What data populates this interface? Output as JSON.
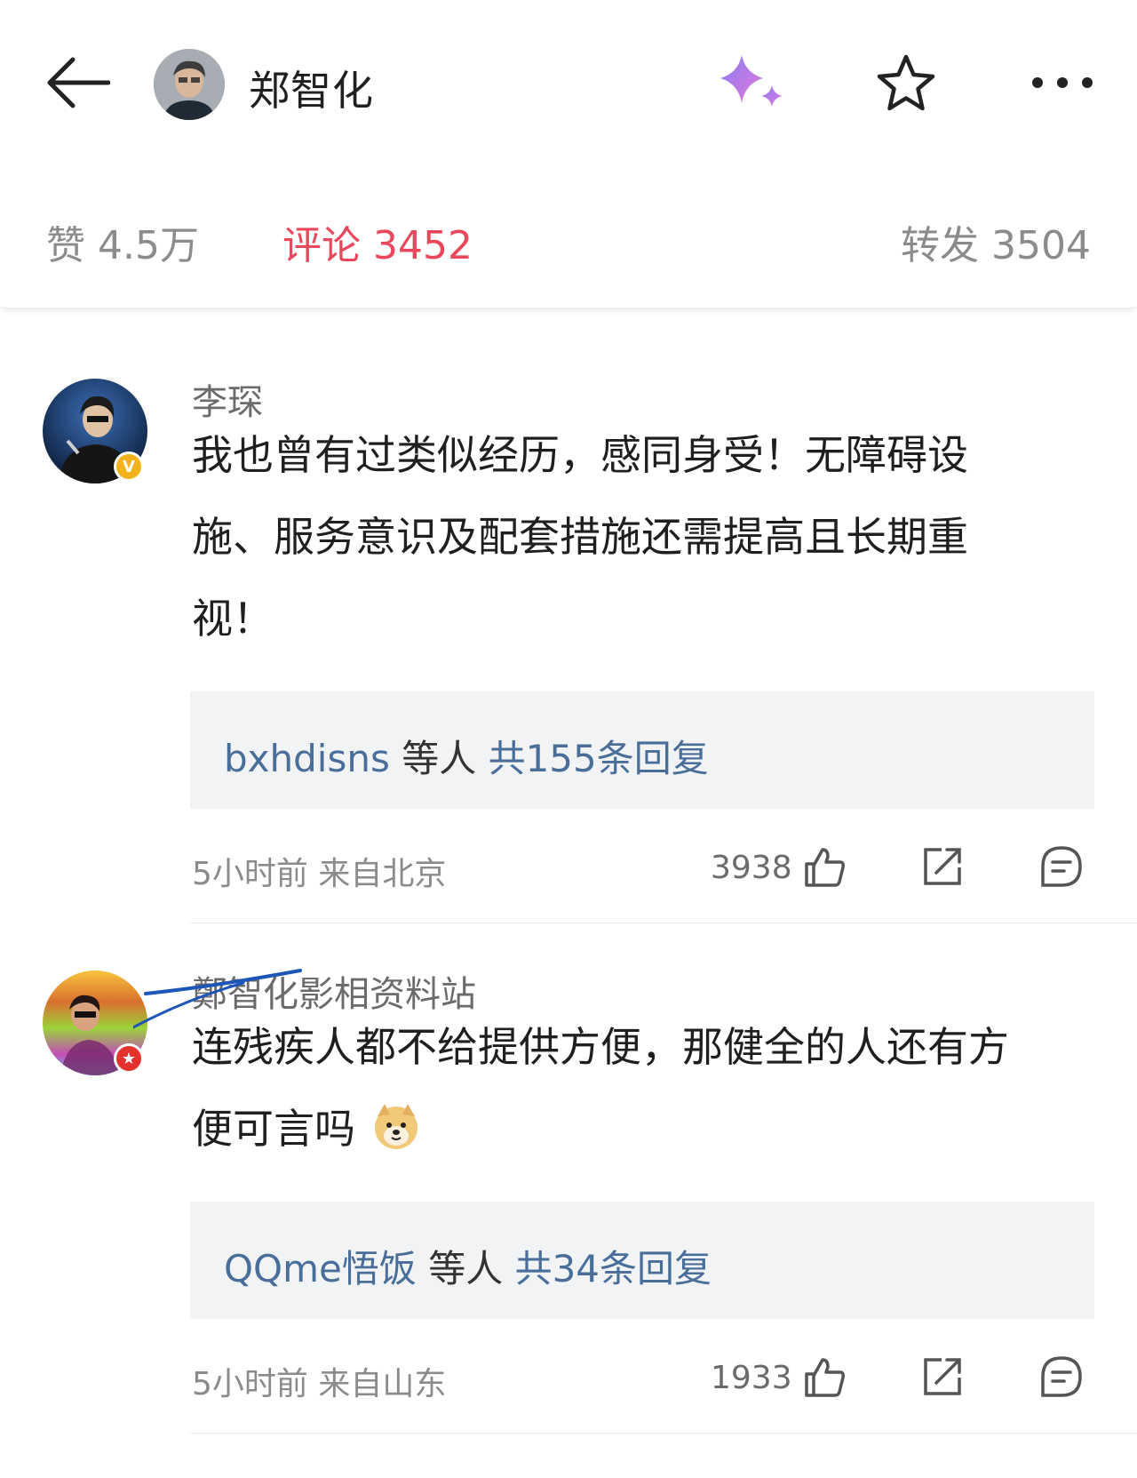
{
  "header": {
    "back_icon": "arrow-left-icon",
    "author_name": "郑智化",
    "ai_icon": "sparkle-icon",
    "favorite_icon": "star-icon",
    "more_icon": "more-dots-icon"
  },
  "stats": {
    "likes": "赞 4.5万",
    "comments": "评论 3452",
    "reposts": "转发 3504",
    "active_color": "#e8475c"
  },
  "comments": [
    {
      "author": "李琛",
      "badge": "V",
      "badge_color": "#f2b21b",
      "text_line1": "我也曾有过类似经历，感同身受！无障碍设",
      "text_line2": "施、服务意识及配套措施还需提高且长期重",
      "text_line3": "视！",
      "reply_user": "bxhdisns",
      "reply_mid": " 等人 ",
      "reply_total": "共155条回复",
      "meta": "5小时前  来自北京",
      "likes": "3938"
    },
    {
      "author": "鄭智化影相资料站",
      "badge": "★",
      "badge_color": "#e5322d",
      "text_line1": "连残疾人都不给提供方便，那健全的人还有方",
      "text_line2": "便可言吗",
      "emoji": "doge-emoji",
      "reply_user": "QQme悟饭",
      "reply_mid": " 等人 ",
      "reply_total": "共34条回复",
      "meta": "5小时前  来自山东",
      "likes": "1933"
    }
  ],
  "action_icons": [
    "thumbs-up-icon",
    "share-icon",
    "comment-icon"
  ],
  "link_color": "#4a6e9a"
}
